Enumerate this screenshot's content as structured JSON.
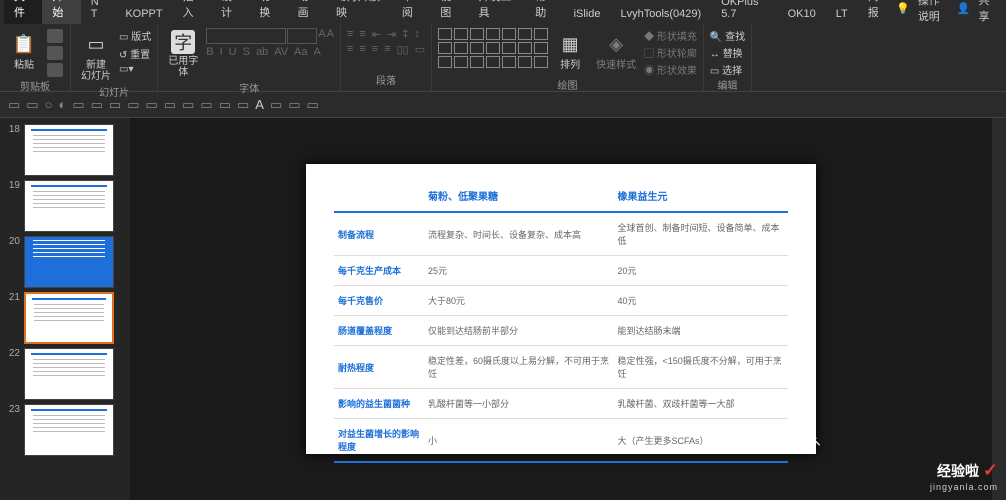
{
  "menu": {
    "file": "文件",
    "start": "开始",
    "nt": "N T",
    "koppt": "KOPPT",
    "insert": "插入",
    "design": "设计",
    "transition": "切换",
    "anim": "动画",
    "slideshow": "幻灯片放映",
    "review": "审阅",
    "view": "视图",
    "dev": "开发工具",
    "help": "帮助",
    "islide": "iSlide",
    "lvyh": "LvyhTools(0429)",
    "okplus": "OKPlus 5.7",
    "ok10": "OK10",
    "lt": "LT",
    "brief": "简报",
    "ops": "操作说明",
    "share": "共享"
  },
  "ribbon": {
    "paste": "粘贴",
    "clipboard": "剪贴板",
    "newslide": "新建\n幻灯片",
    "reset": "重置",
    "layout": "版式",
    "slides": "幻灯片",
    "usedfont": "已用字\n体",
    "font": "字体",
    "para": "段落",
    "arrange": "排列",
    "quick": "快速样式",
    "shapefill": "形状填充",
    "shapeoutline": "形状轮廓",
    "shapefx": "形状效果",
    "drawing": "绘图",
    "find": "查找",
    "replace": "替换",
    "select": "选择",
    "editing": "编辑"
  },
  "thumbs": [
    {
      "n": "18",
      "type": "white"
    },
    {
      "n": "19",
      "type": "white"
    },
    {
      "n": "20",
      "type": "blue"
    },
    {
      "n": "21",
      "type": "sel"
    },
    {
      "n": "22",
      "type": "white"
    },
    {
      "n": "23",
      "type": "white"
    }
  ],
  "slide": {
    "headers": [
      "",
      "菊粉、低聚果糖",
      "橡果益生元"
    ],
    "rows": [
      {
        "h": "制备流程",
        "a": "流程复杂、时间长、设备复杂、成本高",
        "b": "全球首创、制备时间短、设备简单、成本低"
      },
      {
        "h": "每千克生产成本",
        "a": "25元",
        "b": "20元"
      },
      {
        "h": "每千克售价",
        "a": "大于80元",
        "b": "40元"
      },
      {
        "h": "肠道覆盖程度",
        "a": "仅能到达结肠前半部分",
        "b": "能到达结肠末端"
      },
      {
        "h": "耐热程度",
        "a": "稳定性差，60摄氏度以上易分解，不可用于烹饪",
        "b": "稳定性强，<150摄氏度不分解，可用于烹饪"
      },
      {
        "h": "影响的益生菌菌种",
        "a": "乳酸杆菌等一小部分",
        "b": "乳酸杆菌、双歧杆菌等一大部"
      },
      {
        "h": "对益生菌增长的影响程度",
        "a": "小",
        "b": "大（产生更多SCFAs）"
      }
    ]
  },
  "watermark": {
    "main": "经验啦",
    "sub": "jingyanla.com"
  }
}
